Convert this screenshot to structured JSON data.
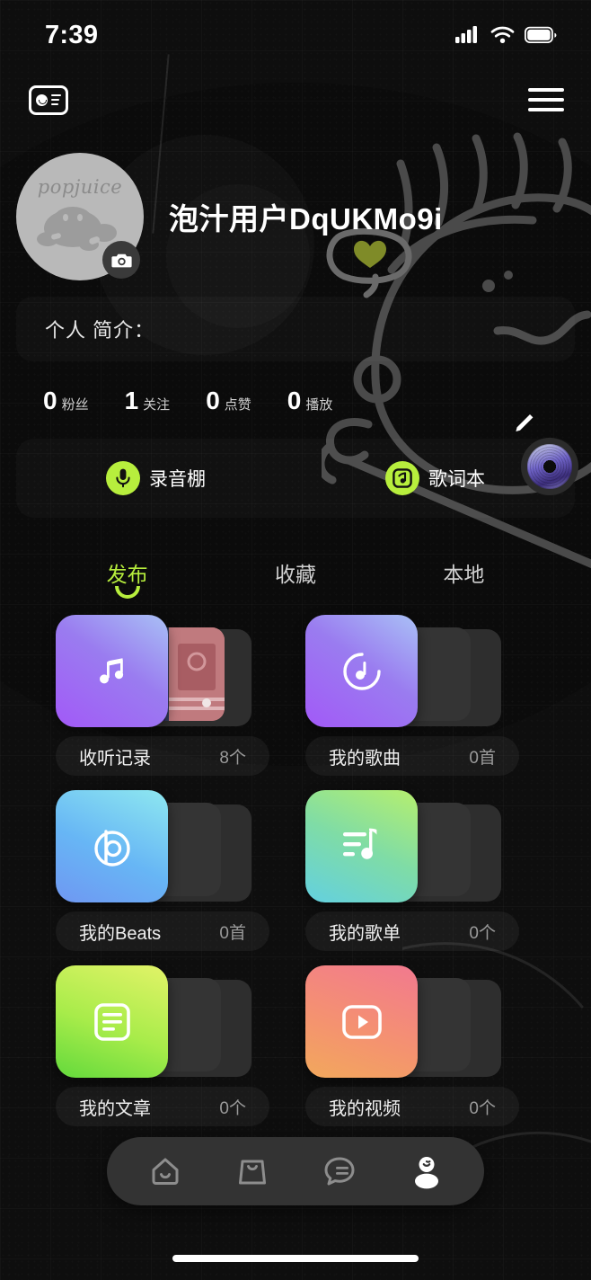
{
  "status_bar": {
    "time": "7:39",
    "icons": [
      "cellular-signal-icon",
      "wifi-icon",
      "battery-icon"
    ]
  },
  "header": {
    "left_icon": "id-card-icon",
    "right_icon": "hamburger-menu-icon"
  },
  "profile": {
    "avatar_text": "popjuice",
    "avatar_badge_icon": "camera-icon",
    "username": "泡汁用户DqUKMo9i",
    "decor_heart_icon": "heart-in-speech-bubble-icon",
    "bio_label": "个人 简介：",
    "edit_icon": "pencil-edit-icon",
    "disc_icon": "vinyl-record-icon"
  },
  "stats": [
    {
      "value": "0",
      "label": "粉丝"
    },
    {
      "value": "1",
      "label": "关注"
    },
    {
      "value": "0",
      "label": "点赞"
    },
    {
      "value": "0",
      "label": "播放"
    }
  ],
  "quick_actions": [
    {
      "label": "录音棚",
      "icon": "microphone-icon",
      "color": "#b7ee3d"
    },
    {
      "label": "歌词本",
      "icon": "lyrics-note-icon",
      "color": "#b7ee3d"
    }
  ],
  "tabs": [
    {
      "label": "发布",
      "active": true
    },
    {
      "label": "收藏",
      "active": false
    },
    {
      "label": "本地",
      "active": false
    }
  ],
  "cards": [
    {
      "title": "收听记录",
      "count": "8个",
      "icon": "music-note-icon",
      "gradient": "g-purple",
      "has_thumb": true
    },
    {
      "title": "我的歌曲",
      "count": "0首",
      "icon": "circle-note-icon",
      "gradient": "g-purple2",
      "has_thumb": false
    },
    {
      "title": "我的Beats",
      "count": "0首",
      "icon": "beats-b-icon",
      "gradient": "g-blue",
      "has_thumb": false
    },
    {
      "title": "我的歌单",
      "count": "0个",
      "icon": "playlist-icon",
      "gradient": "g-mint",
      "has_thumb": false
    },
    {
      "title": "我的文章",
      "count": "0个",
      "icon": "document-icon",
      "gradient": "g-green",
      "has_thumb": false
    },
    {
      "title": "我的视频",
      "count": "0个",
      "icon": "play-video-icon",
      "gradient": "g-orange",
      "has_thumb": false
    }
  ],
  "bottom_nav": [
    {
      "name": "home",
      "icon": "home-icon",
      "active": false
    },
    {
      "name": "shop",
      "icon": "shopping-bag-icon",
      "active": false
    },
    {
      "name": "messages",
      "icon": "chat-bubble-icon",
      "active": false
    },
    {
      "name": "profile",
      "icon": "person-icon",
      "active": true
    }
  ],
  "theme": {
    "accent": "#b7ee3d",
    "background": "#0e0e0e",
    "heart": "#7f8b28"
  }
}
